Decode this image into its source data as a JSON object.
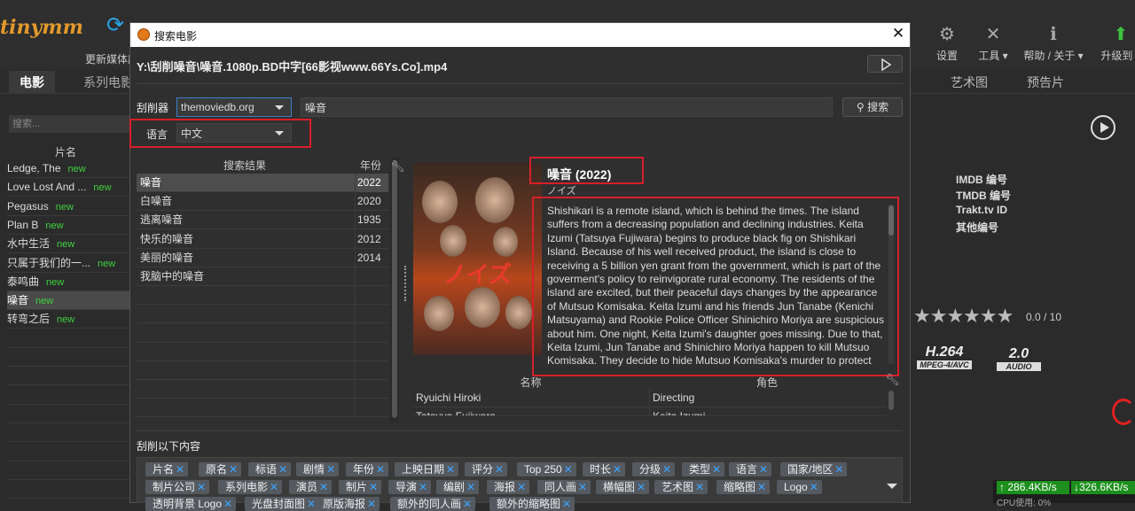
{
  "app": {
    "logo": "tinymm",
    "toolbar": {
      "update_label": "更新媒体库",
      "settings": "设置",
      "tools": "工具",
      "help": "帮助 / 关于",
      "upgrade": "升级到 v"
    },
    "tabs": [
      "电影",
      "系列电影"
    ],
    "right_tabs": [
      "艺术图",
      "预告片"
    ],
    "search_placeholder": "搜索...",
    "list_header": "片名",
    "new_badge": "new",
    "movies": [
      {
        "title": "Ledge, The",
        "new": true
      },
      {
        "title": "Love Lost And ...",
        "new": true
      },
      {
        "title": "Pegasus",
        "new": true
      },
      {
        "title": "Plan B",
        "new": true
      },
      {
        "title": "水中生活",
        "new": true
      },
      {
        "title": "只属于我们的一...",
        "new": true
      },
      {
        "title": "泰鸣曲",
        "new": true
      },
      {
        "title": "噪音",
        "new": true,
        "selected": true
      },
      {
        "title": "转弯之后",
        "new": true
      }
    ],
    "ids": [
      "IMDB 编号",
      "TMDB 编号",
      "Trakt.tv ID",
      "其他编号"
    ],
    "rating_text": "0.0 / 10",
    "stars": "★★★★★★",
    "video_codec": "H.264",
    "video_codec_sub": "MPEG-4/AVC",
    "audio_channels": "2.0",
    "audio_sub": "AUDIO",
    "net_up": "286.4KB/s",
    "net_down": "326.6KB/s",
    "cpu": "CPU使用: 0%"
  },
  "dialog": {
    "title": "搜索电影",
    "close": "✕",
    "file_path": "Y:\\刮削噪音\\噪音.1080p.BD中字[66影视www.66Ys.Co].mp4",
    "scraper_label": "刮削器",
    "scraper_value": "themoviedb.org",
    "query": "噪音",
    "search_button": "搜索",
    "language_label": "语言",
    "language_value": "中文",
    "results_header": "搜索结果",
    "year_header": "年份",
    "results": [
      {
        "title": "噪音",
        "year": "2022",
        "selected": true
      },
      {
        "title": "白噪音",
        "year": "2020"
      },
      {
        "title": "逃离噪音",
        "year": "1935"
      },
      {
        "title": "快乐的噪音",
        "year": "2012"
      },
      {
        "title": "美丽的噪音",
        "year": "2014"
      },
      {
        "title": "我脑中的噪音",
        "year": ""
      }
    ],
    "poster_text": "ノイズ",
    "movie_title": "噪音 (2022)",
    "original_title": "ノイズ",
    "plot": "Shishikari is a remote island, which is behind the times. The island suffers from a decreasing population and declining industries. Keita Izumi (Tatsuya Fujiwara) begins to produce black fig on Shishikari Island. Because of his well received product, the island is close to receiving a 5 billion yen grant from the government, which is part of the goverment's policy to reinvigorate rural economy. The residents of the island are excited, but their peaceful days changes by the appearance of Mutsuo Komisaka.  Keita Izumi and his friends Jun Tanabe (Kenichi Matsuyama) and Rookie Police Officer Shinichiro Moriya are suspicious about him. One night, Keita Izumi's daughter goes missing. Due to that, Keita Izumi, Jun Tanabe and Shinichiro Moriya happen to kill Mutsuo Komisaka. They decide to hide Mutsuo Komisaka's murder to protect",
    "crew_header_name": "名称",
    "crew_header_role": "角色",
    "crew": [
      {
        "name": "Ryuichi Hiroki",
        "role": "Directing"
      },
      {
        "name": "Tatsuya Fujiwara",
        "role": "Keita Izumi"
      }
    ],
    "scrape_label": "刮削以下内容",
    "tags": [
      "片名",
      "原名",
      "标语",
      "剧情",
      "年份",
      "上映日期",
      "评分",
      "Top 250",
      "时长",
      "分级",
      "类型",
      "语言",
      "国家/地区",
      "制片公司",
      "系列电影",
      "演员",
      "制片",
      "导演",
      "编剧",
      "海报",
      "同人画",
      "横幅图",
      "艺术图",
      "缩略图",
      "Logo",
      "透明背景 Logo",
      "光盘封面图",
      "原版海报",
      "额外的同人画",
      "额外的缩略图"
    ]
  }
}
